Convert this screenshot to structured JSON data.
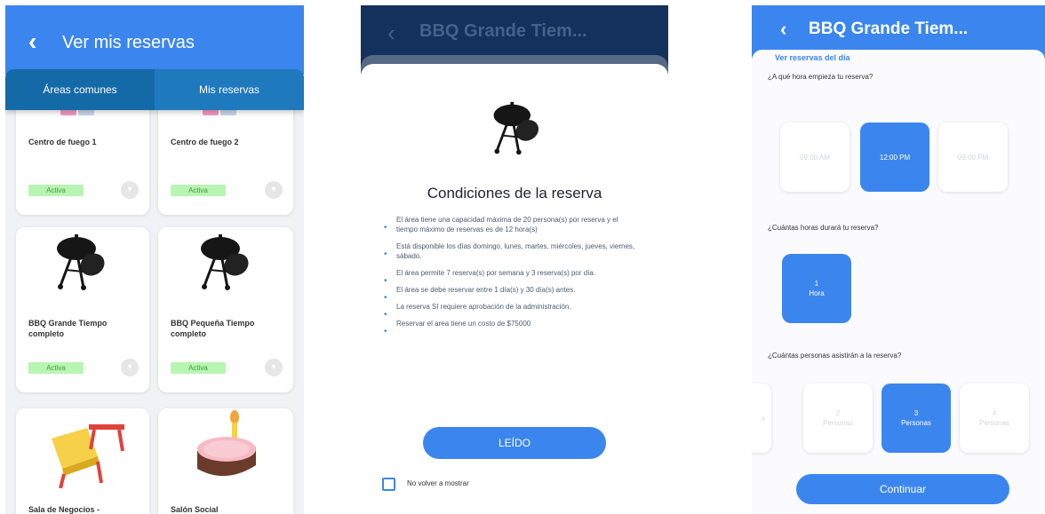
{
  "screen1": {
    "back_icon": "chevron-left-icon",
    "title": "Ver mis reservas",
    "tabs": [
      {
        "label": "Áreas comunes",
        "active": true
      },
      {
        "label": "Mis reservas",
        "active": false
      }
    ],
    "cards": [
      {
        "name": "Centro de fuego 1",
        "status": "Activa",
        "icon": "fire-pit-icon"
      },
      {
        "name": "Centro de fuego 2",
        "status": "Activa",
        "icon": "fire-pit-icon"
      },
      {
        "name": "BBQ Grande Tiempo completo",
        "status": "Activa",
        "icon": "bbq-grill-icon"
      },
      {
        "name": "BBQ  Pequeña Tiempo completo",
        "status": "Activa",
        "icon": "bbq-grill-icon"
      },
      {
        "name": "Sala de Negocios -",
        "status": "",
        "icon": "chair-table-icon"
      },
      {
        "name": "Salón Social",
        "status": "",
        "icon": "cake-icon"
      }
    ],
    "chevron_icon": "chevron-down-icon",
    "colors": {
      "header": "#3b86ee",
      "tabs": "#1d6fb4",
      "status_bg": "#b9f5b2",
      "status_text": "#3b9b3e"
    }
  },
  "screen2": {
    "back_icon": "chevron-left-icon",
    "title": "BBQ Grande Tiem...",
    "modal": {
      "icon": "bbq-grill-icon",
      "title": "Condiciones de la reserva",
      "conditions": [
        "El área tiene una capacidad máxima de 20 persona(s) por reserva y el tiempo máximo de reservas es de 12 hora(s)",
        "Está disponible los días domingo, lunes, martes, miércoles, jueves, viernes, sábado.",
        "El área permite 7 reserva(s) por semana y 3 reserva(s) por día.",
        "El área se debe reservar entre 1 día(s) y 30 día(s) antes.",
        "La reserva SI requiere aprobación de la administración.",
        "Reservar el area tiene un costo de $75000"
      ],
      "button": "LEÍDO",
      "checkbox_label": "No volver a mostrar"
    }
  },
  "screen3": {
    "back_icon": "chevron-left-icon",
    "title": "BBQ Grande Tiem...",
    "link": "Ver reservas del día",
    "q1": "¿A qué hora empieza tu reserva?",
    "times": [
      {
        "label": "09:00 AM",
        "selected": false
      },
      {
        "label": "12:00 PM",
        "selected": true
      },
      {
        "label": "09:00 PM",
        "selected": false
      }
    ],
    "q2": "¿Cuántas horas durará tu reserva?",
    "hours": [
      {
        "n": "1",
        "unit": "Hora",
        "selected": true
      }
    ],
    "q3": "¿Cuántas personas asistirán a la reserva?",
    "people": [
      {
        "n": "",
        "unit": "s",
        "selected": false
      },
      {
        "n": "2",
        "unit": "Personas",
        "selected": false
      },
      {
        "n": "3",
        "unit": "Personas",
        "selected": true
      },
      {
        "n": "4",
        "unit": "Personas",
        "selected": false
      }
    ],
    "button": "Continuar"
  }
}
